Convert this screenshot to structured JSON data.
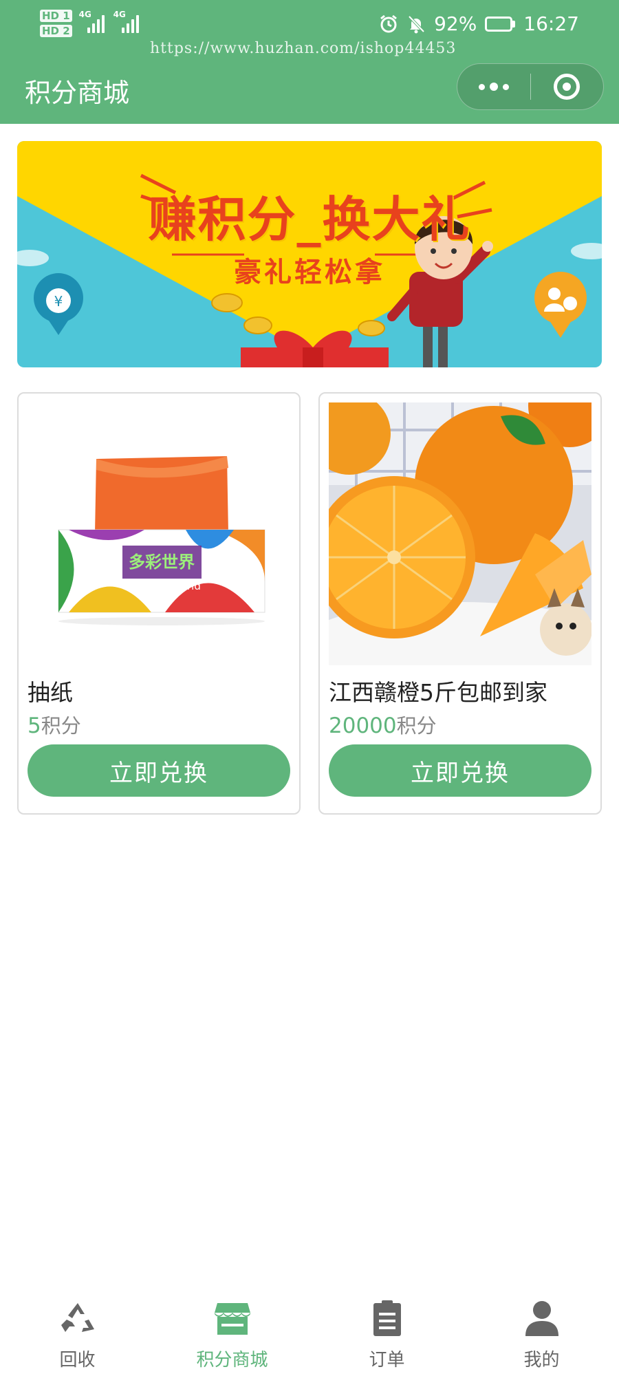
{
  "status_bar": {
    "hd1": "HD 1",
    "hd2": "HD 2",
    "net1": "4G",
    "net2": "4G",
    "battery": "92%",
    "battery_level": 0.92,
    "time": "16:27",
    "icons": [
      "alarm-icon",
      "bell-off-icon"
    ]
  },
  "watermark": "https://www.huzhan.com/ishop44453",
  "header": {
    "title": "积分商城",
    "more_icon": "more-dots-icon",
    "close_icon": "target-close-icon"
  },
  "banner": {
    "title": "赚积分_换大礼",
    "subtitle": "豪礼轻松拿",
    "colors": {
      "top": "#ffd600",
      "sky": "#4ec6d8",
      "text": "#e8421d"
    }
  },
  "products": [
    {
      "name": "抽纸",
      "points": "5",
      "points_unit": "积分",
      "button": "立即兑换",
      "image_icon": "tissue-box-image",
      "image_text": "多彩世界",
      "image_text_en": "Colourful world"
    },
    {
      "name": "江西赣橙5斤包邮到家",
      "points": "20000",
      "points_unit": "积分",
      "button": "立即兑换",
      "image_icon": "orange-image"
    }
  ],
  "tabbar": {
    "items": [
      {
        "label": "回收",
        "icon": "recycle-icon",
        "active": false
      },
      {
        "label": "积分商城",
        "icon": "store-icon",
        "active": true
      },
      {
        "label": "订单",
        "icon": "clipboard-icon",
        "active": false
      },
      {
        "label": "我的",
        "icon": "user-icon",
        "active": false
      }
    ]
  },
  "colors": {
    "primary": "#5fb57c",
    "inactive": "#666666"
  }
}
